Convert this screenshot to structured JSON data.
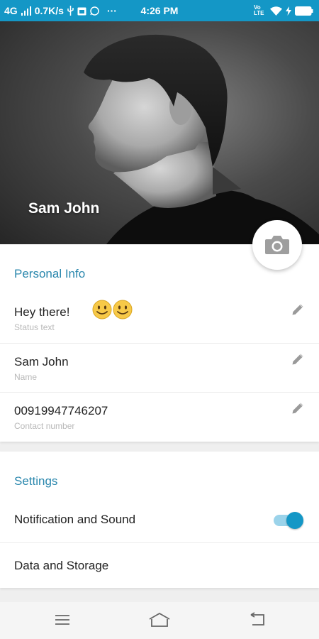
{
  "status_bar": {
    "network": "4G",
    "speed": "0.7K/s",
    "time": "4:26 PM",
    "more": "···",
    "volte": "Vo LTE",
    "icons": [
      "signal-icon",
      "usb-icon",
      "calendar-icon",
      "whatsapp-icon",
      "wifi-icon",
      "charging-icon",
      "battery-icon"
    ]
  },
  "profile": {
    "name": "Sam John",
    "camera_icon": "camera-icon"
  },
  "personal_info": {
    "title": "Personal Info",
    "status": {
      "value": "Hey there!",
      "label": "Status text",
      "emoji": "🙂🙂"
    },
    "name": {
      "value": "Sam John",
      "label": "Name"
    },
    "contact": {
      "value": "00919947746207",
      "label": "Contact number"
    },
    "edit_icon": "pencil-icon"
  },
  "settings": {
    "title": "Settings",
    "notification": {
      "label": "Notification and Sound",
      "enabled": true
    },
    "data_storage": {
      "label": "Data and Storage"
    }
  },
  "colors": {
    "accent": "#1497c6",
    "section_title": "#2a87ad",
    "toggle_track": "#9bd3ea"
  },
  "navigation": {
    "buttons": [
      "menu-icon",
      "home-icon",
      "back-icon"
    ]
  }
}
